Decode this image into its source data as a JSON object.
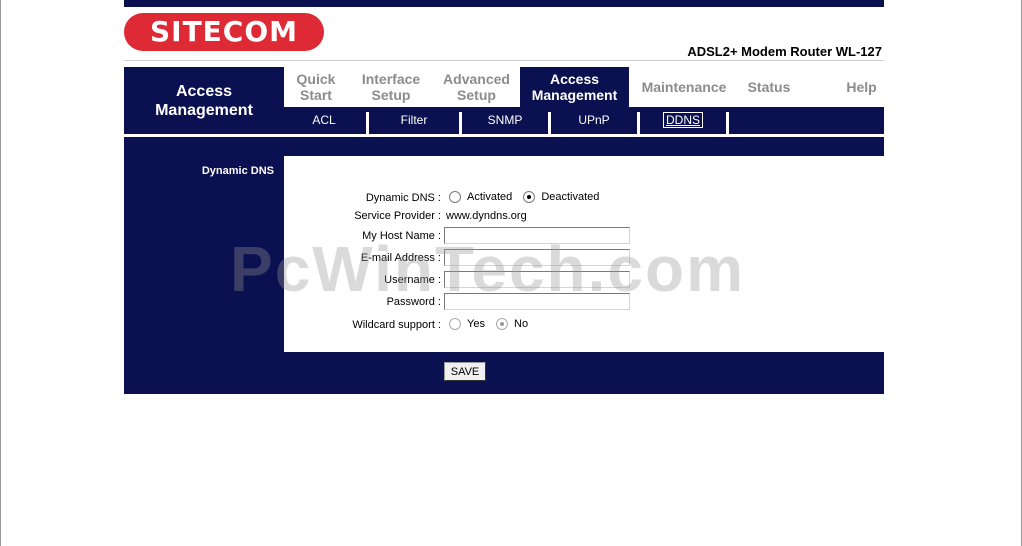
{
  "brand": {
    "logo_text": "SITECOM",
    "model": "ADSL2+ Modem Router WL-127"
  },
  "section": {
    "title": "Access\nManagement"
  },
  "tabs": [
    {
      "label": "Quick\nStart",
      "active": false
    },
    {
      "label": "Interface\nSetup",
      "active": false
    },
    {
      "label": "Advanced\nSetup",
      "active": false
    },
    {
      "label": "Access\nManagement",
      "active": true
    },
    {
      "label": "Maintenance",
      "active": false
    },
    {
      "label": "Status",
      "active": false
    },
    {
      "label": "Help",
      "active": false
    }
  ],
  "subtabs": [
    {
      "label": "ACL",
      "active": false
    },
    {
      "label": "Filter",
      "active": false
    },
    {
      "label": "SNMP",
      "active": false
    },
    {
      "label": "UPnP",
      "active": false
    },
    {
      "label": "DDNS",
      "active": true
    }
  ],
  "left_label": "Dynamic DNS",
  "form": {
    "dynamic_dns": {
      "label": "Dynamic DNS :",
      "options": [
        "Activated",
        "Deactivated"
      ],
      "selected": "Deactivated"
    },
    "service_provider": {
      "label": "Service Provider :",
      "value": "www.dyndns.org"
    },
    "host_name": {
      "label": "My Host Name :",
      "value": ""
    },
    "email": {
      "label": "E-mail Address :",
      "value": ""
    },
    "username": {
      "label": "Username :",
      "value": ""
    },
    "password": {
      "label": "Password :",
      "value": ""
    },
    "wildcard": {
      "label": "Wildcard support :",
      "options": [
        "Yes",
        "No"
      ],
      "selected": "No"
    }
  },
  "save_label": "SAVE",
  "watermark": "PcWinTech.com",
  "colors": {
    "navy": "#0b1150",
    "brand_red": "#dd2a35",
    "tab_inactive": "#8c8c8c"
  }
}
